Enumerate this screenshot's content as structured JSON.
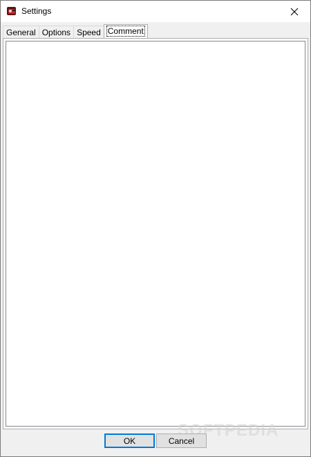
{
  "window": {
    "title": "Settings"
  },
  "tabs": [
    {
      "label": "General"
    },
    {
      "label": "Options"
    },
    {
      "label": "Speed"
    },
    {
      "label": "Comment",
      "active": true
    }
  ],
  "buttons": {
    "ok": "OK",
    "cancel": "Cancel"
  },
  "watermark": "SOFTPEDIA",
  "colors": {
    "accent": "#0078d7",
    "close_icon": "#000000"
  },
  "icons": {
    "app": "app-icon",
    "close": "close-icon"
  }
}
